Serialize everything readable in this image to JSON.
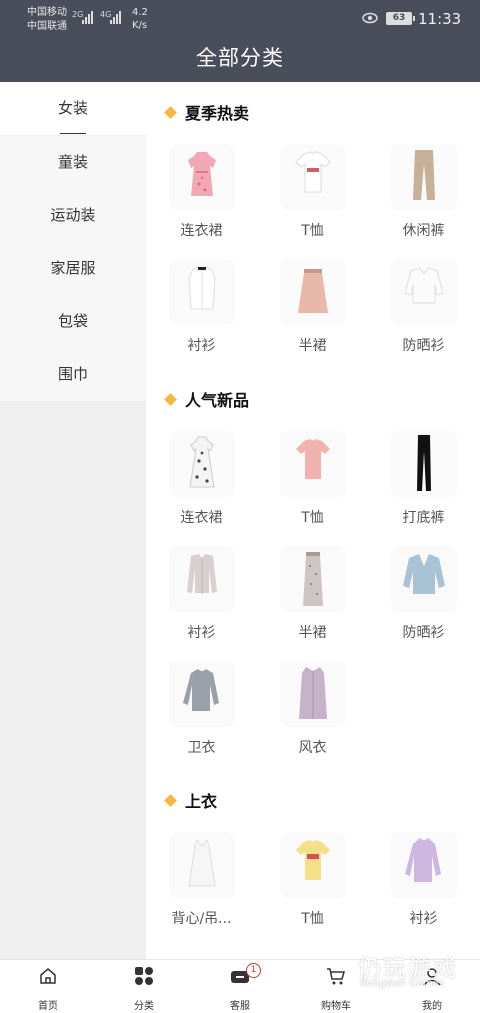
{
  "status_bar": {
    "carrier1": "中国移动",
    "carrier2": "中国联通",
    "net1": "2G",
    "net2": "4G",
    "speed_value": "4.2",
    "speed_unit": "K/s",
    "battery": "63",
    "time": "11:33"
  },
  "header": {
    "title": "全部分类"
  },
  "sidebar": {
    "items": [
      {
        "label": "女装",
        "active": true
      },
      {
        "label": "童装"
      },
      {
        "label": "运动装"
      },
      {
        "label": "家居服"
      },
      {
        "label": "包袋"
      },
      {
        "label": "围巾"
      }
    ]
  },
  "sections": [
    {
      "title": "夏季热卖",
      "items": [
        {
          "label": "连衣裙",
          "icon": "dress-icon"
        },
        {
          "label": "T恤",
          "icon": "tshirt-icon"
        },
        {
          "label": "休闲裤",
          "icon": "pants-icon"
        },
        {
          "label": "衬衫",
          "icon": "shirt-icon"
        },
        {
          "label": "半裙",
          "icon": "skirt-icon"
        },
        {
          "label": "防晒衫",
          "icon": "sun-shirt-icon"
        }
      ]
    },
    {
      "title": "人气新品",
      "items": [
        {
          "label": "连衣裙",
          "icon": "dress-icon"
        },
        {
          "label": "T恤",
          "icon": "tshirt-icon"
        },
        {
          "label": "打底裤",
          "icon": "leggings-icon"
        },
        {
          "label": "衬衫",
          "icon": "shirt-icon"
        },
        {
          "label": "半裙",
          "icon": "skirt-icon"
        },
        {
          "label": "防晒衫",
          "icon": "cardigan-icon"
        },
        {
          "label": "卫衣",
          "icon": "sweater-icon"
        },
        {
          "label": "风衣",
          "icon": "trench-coat-icon"
        }
      ]
    },
    {
      "title": "上衣",
      "items": [
        {
          "label": "背心/吊...",
          "icon": "camisole-icon"
        },
        {
          "label": "T恤",
          "icon": "tshirt-icon"
        },
        {
          "label": "衬衫",
          "icon": "hoodie-icon"
        }
      ]
    }
  ],
  "bottom_nav": {
    "items": [
      {
        "label": "首页",
        "icon": "home-icon"
      },
      {
        "label": "分类",
        "icon": "category-icon"
      },
      {
        "label": "客服",
        "icon": "service-icon",
        "badge": "1"
      },
      {
        "label": "购物车",
        "icon": "cart-icon"
      },
      {
        "label": "我的",
        "icon": "user-icon"
      }
    ]
  },
  "watermark": {
    "text": "仍玩游戏",
    "sub": "Rengwan Games"
  },
  "colors": {
    "header_bg": "#4a4d5a",
    "accent": "#f5b73d",
    "badge": "#c0392b"
  }
}
